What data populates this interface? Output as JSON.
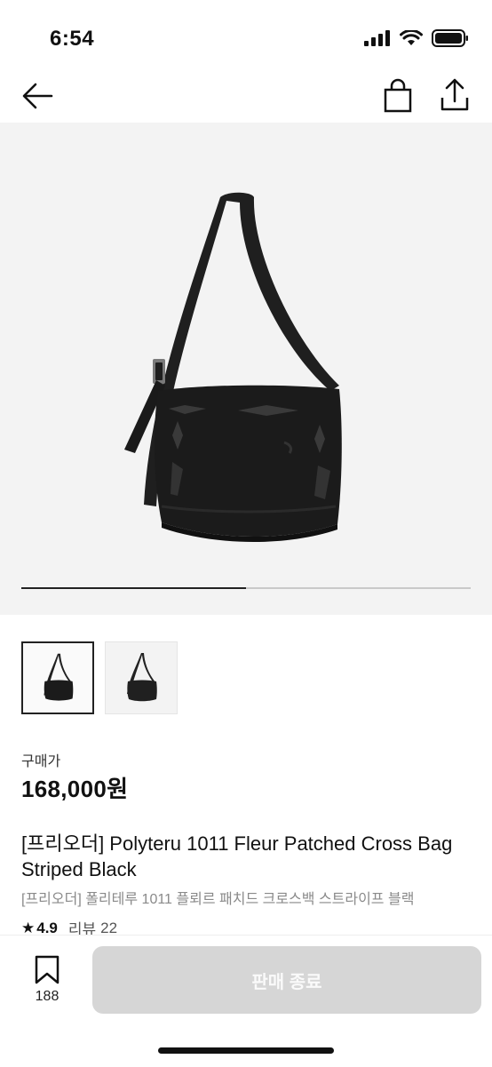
{
  "status_bar": {
    "time": "6:54"
  },
  "nav": {
    "back_icon": "arrow-left-icon",
    "bag_icon": "shopping-bag-icon",
    "share_icon": "share-icon"
  },
  "gallery": {
    "current_index": 1,
    "total_images": 2,
    "progress_fraction": 0.5
  },
  "price": {
    "label": "구매가",
    "value": "168,000원"
  },
  "product": {
    "title": "[프리오더] Polyteru 1011 Fleur Patched Cross Bag Striped Black",
    "subtitle": "[프리오더] 폴리테루 1011 플뢰르 패치드 크로스백 스트라이프 블랙"
  },
  "rating": {
    "star": "★",
    "value": "4.9",
    "review_label": "리뷰",
    "review_count": "22"
  },
  "bottom": {
    "wish_count": "188",
    "sold_button_label": "판매 종료"
  },
  "colors": {
    "accent": "#222222",
    "disabled_button": "#d6d6d6",
    "hero_bg": "#f3f3f3"
  }
}
